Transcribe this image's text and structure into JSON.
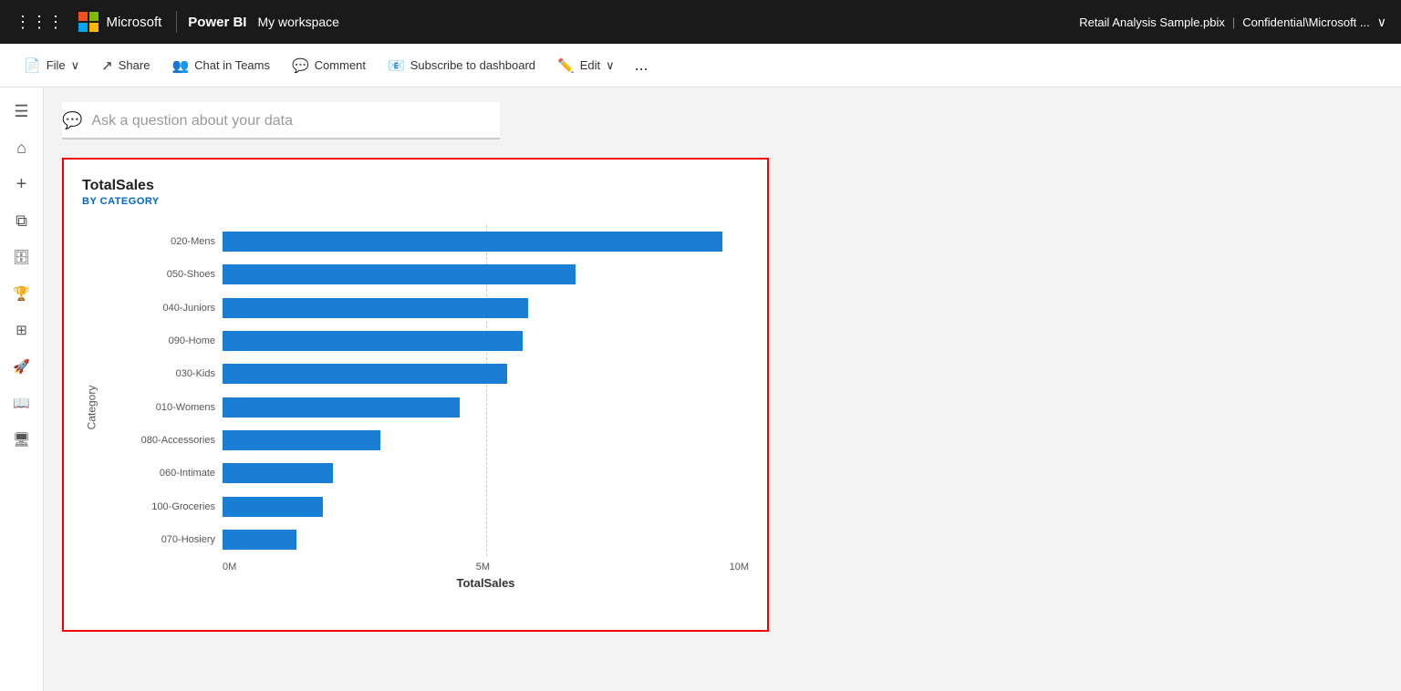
{
  "topbar": {
    "dots_icon": "⋮⋮⋮",
    "ms_brand": "Microsoft",
    "powerbi_label": "Power BI",
    "workspace_label": "My workspace",
    "file_title": "Retail Analysis Sample.pbix",
    "file_separator": "|",
    "confidential_label": "Confidential\\Microsoft ...",
    "chevron": "∨"
  },
  "toolbar": {
    "file_label": "File",
    "share_label": "Share",
    "chat_label": "Chat in Teams",
    "comment_label": "Comment",
    "subscribe_label": "Subscribe to dashboard",
    "edit_label": "Edit",
    "more_label": "..."
  },
  "sidebar": {
    "items": [
      {
        "name": "hamburger",
        "icon": "☰"
      },
      {
        "name": "home",
        "icon": "⌂"
      },
      {
        "name": "plus",
        "icon": "+"
      },
      {
        "name": "pages",
        "icon": "⧉"
      },
      {
        "name": "database",
        "icon": "🗄"
      },
      {
        "name": "trophy",
        "icon": "🏆"
      },
      {
        "name": "grid",
        "icon": "⊞"
      },
      {
        "name": "rocket",
        "icon": "🚀"
      },
      {
        "name": "book",
        "icon": "📖"
      },
      {
        "name": "monitor",
        "icon": "🖥"
      }
    ]
  },
  "ask_bar": {
    "placeholder": "Ask a question about your data",
    "icon": "💬"
  },
  "chart": {
    "title": "TotalSales",
    "subtitle": "BY CATEGORY",
    "x_axis_label": "TotalSales",
    "y_axis_label": "Category",
    "x_ticks": [
      "0M",
      "5M",
      "10M"
    ],
    "x_tick_positions": [
      0,
      50,
      100
    ],
    "bars": [
      {
        "label": "020-Mens",
        "value": 9500000,
        "pct": 95
      },
      {
        "label": "050-Shoes",
        "value": 6700000,
        "pct": 67
      },
      {
        "label": "040-Juniors",
        "value": 5800000,
        "pct": 58
      },
      {
        "label": "090-Home",
        "value": 5700000,
        "pct": 57
      },
      {
        "label": "030-Kids",
        "value": 5400000,
        "pct": 54
      },
      {
        "label": "010-Womens",
        "value": 4500000,
        "pct": 45
      },
      {
        "label": "080-Accessories",
        "value": 3000000,
        "pct": 30
      },
      {
        "label": "060-Intimate",
        "value": 2100000,
        "pct": 21
      },
      {
        "label": "100-Groceries",
        "value": 1900000,
        "pct": 19
      },
      {
        "label": "070-Hosiery",
        "value": 1400000,
        "pct": 14
      }
    ],
    "bar_color": "#1a7fd4",
    "gridline_positions": [
      50
    ]
  }
}
